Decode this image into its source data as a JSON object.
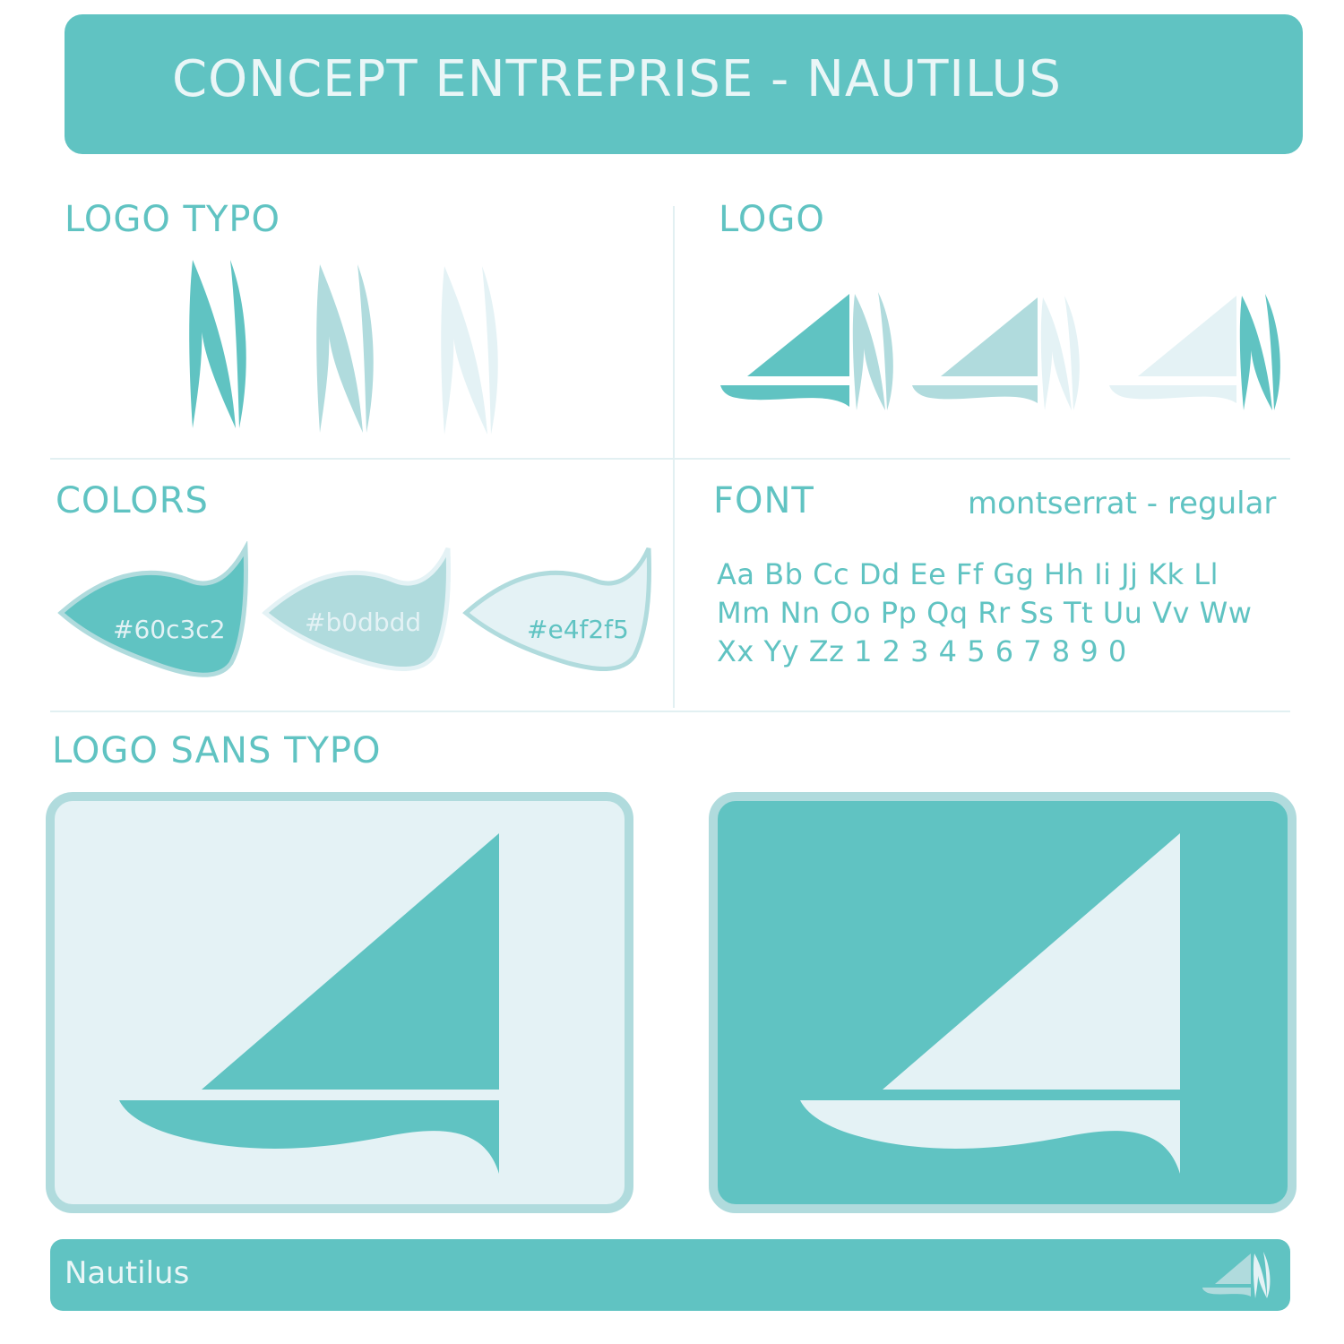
{
  "header": {
    "title": "CONCEPT ENTREPRISE - NAUTILUS"
  },
  "sections": {
    "logo_typo": "LOGO TYPO",
    "logo": "LOGO",
    "colors": "COLORS",
    "font": "FONT",
    "logo_sans_typo": "LOGO SANS TYPO"
  },
  "colors": {
    "primary": "#60c3c2",
    "secondary": "#b0dbdd",
    "light": "#e4f2f5",
    "swatches": [
      {
        "label": "#60c3c2",
        "fill": "#60c3c2",
        "text_color": "#e4f2f5"
      },
      {
        "label": "#b0dbdd",
        "fill": "#b0dbdd",
        "text_color": "#e4f2f5"
      },
      {
        "label": "#e4f2f5",
        "fill": "#e4f2f5",
        "text_color": "#60c3c2"
      }
    ]
  },
  "font": {
    "name": "montserrat - regular",
    "lines": [
      "Aa Bb Cc Dd Ee Ff Gg Hh Ii Jj Kk Ll",
      "Mm Nn Oo Pp Qq Rr Ss Tt Uu Vv Ww",
      "Xx Yy Zz 1 2 3 4 5 6 7 8 9 0"
    ]
  },
  "icons": {
    "letter_n": "logo-letter-n-icon",
    "sailboat_logo": "sailboat-logo-icon",
    "sailboat": "sailboat-icon"
  },
  "footer": {
    "brand": "Nautilus"
  }
}
